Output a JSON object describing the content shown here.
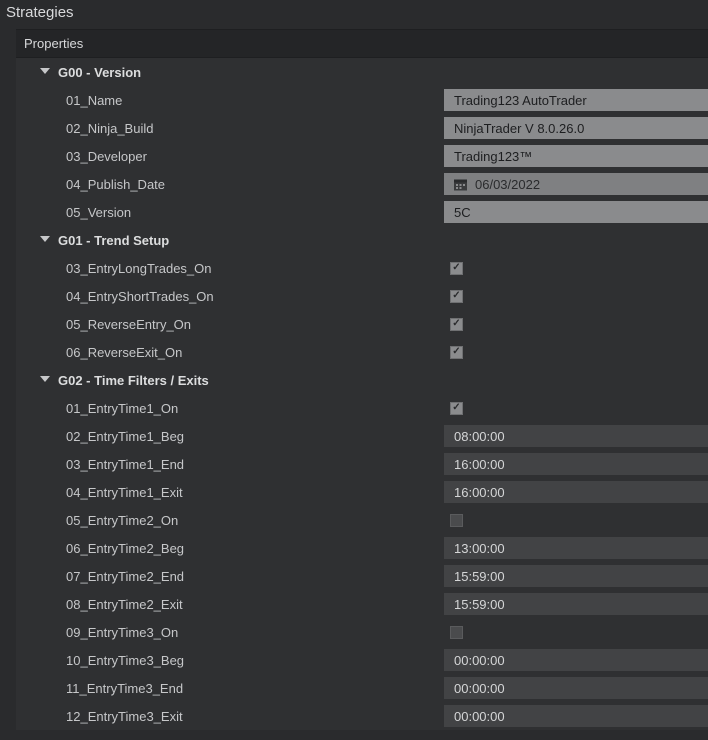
{
  "titles": {
    "strategies": "Strategies",
    "properties": "Properties"
  },
  "groups": {
    "g00": {
      "title": "G00 - Version",
      "rows": {
        "name": {
          "label": "01_Name",
          "value": "Trading123 AutoTrader"
        },
        "ninja_build": {
          "label": "02_Ninja_Build",
          "value": "NinjaTrader V 8.0.26.0"
        },
        "developer": {
          "label": "03_Developer",
          "value": "Trading123™"
        },
        "publish_date": {
          "label": "04_Publish_Date",
          "value": "06/03/2022"
        },
        "version": {
          "label": "05_Version",
          "value": "5C"
        }
      }
    },
    "g01": {
      "title": "G01 - Trend Setup",
      "rows": {
        "entry_long": {
          "label": "03_EntryLongTrades_On",
          "checked": true
        },
        "entry_short": {
          "label": "04_EntryShortTrades_On",
          "checked": true
        },
        "rev_entry": {
          "label": "05_ReverseEntry_On",
          "checked": true
        },
        "rev_exit": {
          "label": "06_ReverseExit_On",
          "checked": true
        }
      }
    },
    "g02": {
      "title": "G02 - Time Filters / Exits",
      "rows": {
        "t1_on": {
          "label": "01_EntryTime1_On",
          "checked": true
        },
        "t1_beg": {
          "label": "02_EntryTime1_Beg",
          "value": "08:00:00"
        },
        "t1_end": {
          "label": "03_EntryTime1_End",
          "value": "16:00:00"
        },
        "t1_exit": {
          "label": "04_EntryTime1_Exit",
          "value": "16:00:00"
        },
        "t2_on": {
          "label": "05_EntryTime2_On",
          "checked": false
        },
        "t2_beg": {
          "label": "06_EntryTime2_Beg",
          "value": "13:00:00"
        },
        "t2_end": {
          "label": "07_EntryTime2_End",
          "value": "15:59:00"
        },
        "t2_exit": {
          "label": "08_EntryTime2_Exit",
          "value": "15:59:00"
        },
        "t3_on": {
          "label": "09_EntryTime3_On",
          "checked": false
        },
        "t3_beg": {
          "label": "10_EntryTime3_Beg",
          "value": "00:00:00"
        },
        "t3_end": {
          "label": "11_EntryTime3_End",
          "value": "00:00:00"
        },
        "t3_exit": {
          "label": "12_EntryTime3_Exit",
          "value": "00:00:00"
        }
      }
    }
  }
}
